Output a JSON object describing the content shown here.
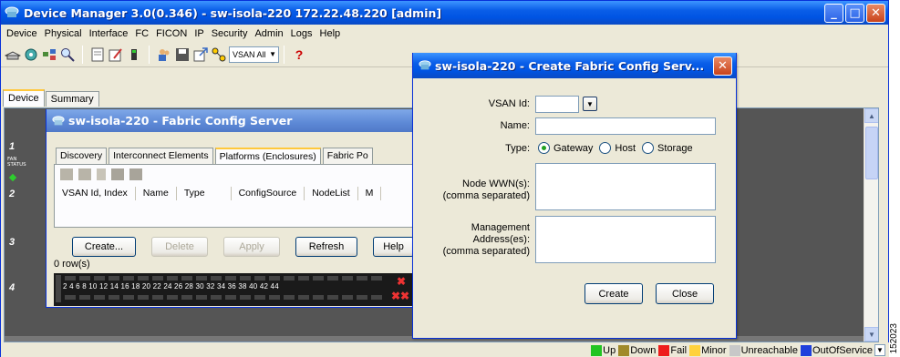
{
  "window": {
    "title": "Device Manager 3.0(0.346) - sw-isola-220 172.22.48.220 [admin]",
    "min_btn": "_",
    "max_btn": "□",
    "close_btn": "✕"
  },
  "menu": [
    "Device",
    "Physical",
    "Interface",
    "FC",
    "FICON",
    "IP",
    "Security",
    "Admin",
    "Logs",
    "Help"
  ],
  "toolbar": {
    "icons": [
      "open-icon",
      "discover-icon",
      "switch-icon",
      "zoom-icon",
      "summary-icon",
      "config-icon",
      "inventory-icon",
      "users-icon",
      "save-icon",
      "launch-icon",
      "flow-icon",
      "help-icon"
    ],
    "vsan_select": "VSAN All",
    "vsan_arrow": "▼",
    "help_glyph": "?"
  },
  "tabs": {
    "device": "Device",
    "summary": "Summary"
  },
  "device_view": {
    "slots": [
      "1",
      "2",
      "3",
      "4"
    ],
    "fan_status": "FAN STATUS"
  },
  "inner_window": {
    "title": "sw-isola-220 - Fabric Config Server",
    "tabs": [
      "Discovery",
      "Interconnect Elements",
      "Platforms (Enclosures)",
      "Fabric Po"
    ],
    "columns": [
      "VSAN Id, Index",
      "Name",
      "Type",
      "ConfigSource",
      "NodeList",
      "M"
    ],
    "buttons": {
      "create": "Create...",
      "delete": "Delete",
      "apply": "Apply",
      "refresh": "Refresh",
      "help": "Help"
    },
    "row_count": "0 row(s)",
    "port_numbers": "2  4  6  8  10 12 14 16 18 20 22 24 26 28 30 32 34 36 38 40 42 44"
  },
  "dialog": {
    "title": "sw-isola-220 - Create Fabric Config Serv...",
    "close_btn": "✕",
    "vsan_label": "VSAN Id:",
    "vsan_value": "",
    "name_label": "Name:",
    "name_value": "",
    "type_label": "Type:",
    "type_options": [
      "Gateway",
      "Host",
      "Storage"
    ],
    "type_selected": "Gateway",
    "node_wwn_label_1": "Node WWN(s):",
    "node_wwn_label_2": "(comma separated)",
    "mgmt_label_1": "Management",
    "mgmt_label_2": "Address(es):",
    "mgmt_label_3": "(comma separated)",
    "create_btn": "Create",
    "close_btn_label": "Close"
  },
  "status_legend": [
    {
      "label": "Up",
      "color": "#22c422"
    },
    {
      "label": "Down",
      "color": "#a08a2a"
    },
    {
      "label": "Fail",
      "color": "#ee1c1c"
    },
    {
      "label": "Minor",
      "color": "#ffd23c"
    },
    {
      "label": "Unreachable",
      "color": "#c8c8c8"
    },
    {
      "label": "OutOfService",
      "color": "#1f3fdc"
    }
  ],
  "figure_id": "152023"
}
